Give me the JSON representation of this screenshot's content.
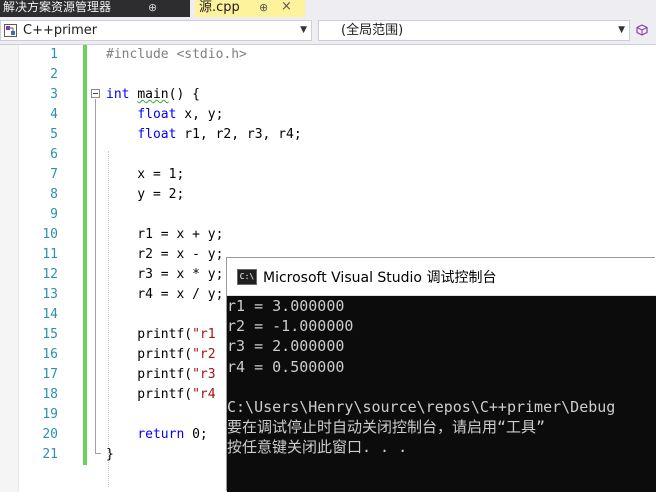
{
  "tabs": {
    "solution_explorer": "解决方案资源管理器",
    "solution_pin": "⊕",
    "file_tab": "源.cpp",
    "file_pin": "⊕",
    "file_close": "×"
  },
  "navbar": {
    "project": "C++primer",
    "scope": "(全局范围)"
  },
  "editor": {
    "line_numbers": [
      "1",
      "2",
      "3",
      "4",
      "5",
      "6",
      "7",
      "8",
      "9",
      "10",
      "11",
      "12",
      "13",
      "14",
      "15",
      "16",
      "17",
      "18",
      "19",
      "20",
      "21"
    ],
    "lines": [
      "#include <stdio.h>",
      "",
      "int main() {",
      "    float x, y;",
      "    float r1, r2, r3, r4;",
      "",
      "    x = 1;",
      "    y = 2;",
      "",
      "    r1 = x + y;",
      "    r2 = x - y;",
      "    r3 = x * y;",
      "    r4 = x / y;",
      "",
      "    printf(\"r1",
      "    printf(\"r2",
      "    printf(\"r3",
      "    printf(\"r4",
      "",
      "    return 0;",
      "}"
    ]
  },
  "console": {
    "icon_text": "C:\\",
    "title": "Microsoft Visual Studio 调试控制台",
    "output": [
      "r1 = 3.000000",
      "r2 = -1.000000",
      "r3 = 2.000000",
      "r4 = 0.500000",
      "",
      "C:\\Users\\Henry\\source\\repos\\C++primer\\Debug",
      "要在调试停止时自动关闭控制台，请启用“工具”",
      "按任意键关闭此窗口. . ."
    ]
  },
  "colors": {
    "keyword": "#0000ff",
    "preprocessor": "#808080",
    "line_number": "#2b91af",
    "change_bar": "#6cd05e",
    "active_tab": "#fff29d",
    "console_bg": "#0c0c0c",
    "console_text": "#cccccc"
  }
}
